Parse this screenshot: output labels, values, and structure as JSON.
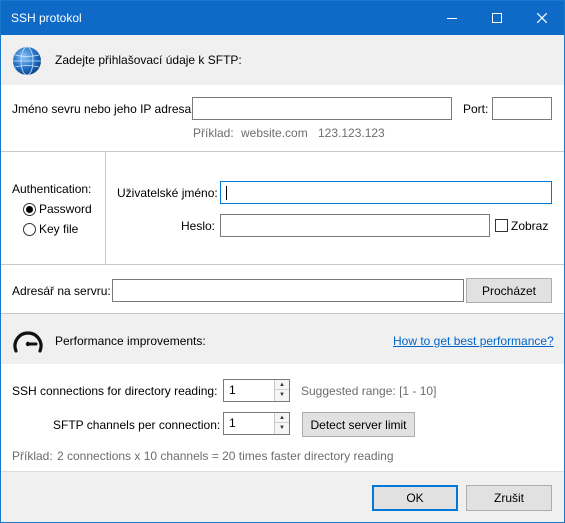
{
  "window": {
    "title": "SSH protokol"
  },
  "header": {
    "text": "Zadejte přihlašovací údaje k SFTP:",
    "icon": "globe-icon"
  },
  "server": {
    "label": "Jméno sevru nebo jeho IP adresa:",
    "value": "",
    "port_label": "Port:",
    "port_value": "",
    "example_label": "Příklad:",
    "example_1": "website.com",
    "example_2": "123.123.123"
  },
  "auth": {
    "label": "Authentication:",
    "options": [
      "Password",
      "Key file"
    ],
    "selected": "Password",
    "username_label": "Uživatelské jméno:",
    "username_value": "",
    "password_label": "Heslo:",
    "password_value": "",
    "show_label": "Zobraz"
  },
  "directory": {
    "label": "Adresář na servru:",
    "value": "",
    "browse_label": "Procházet"
  },
  "performance": {
    "label": "Performance improvements:",
    "link": "How to get best performance?",
    "icon": "speedometer-icon"
  },
  "connections": {
    "ssh_label": "SSH connections for directory reading:",
    "ssh_value": "1",
    "suggested": "Suggested range: [1 - 10]",
    "sftp_label": "SFTP channels per connection:",
    "sftp_value": "1",
    "detect_label": "Detect server limit",
    "example_label": "Příklad:",
    "example_text": "2 connections x 10 channels = 20 times faster directory reading"
  },
  "footer": {
    "ok_label": "OK",
    "cancel_label": "Zrušit"
  },
  "colors": {
    "titlebar": "#0e6ac6",
    "link": "#0066cc",
    "focus": "#0078d7"
  }
}
